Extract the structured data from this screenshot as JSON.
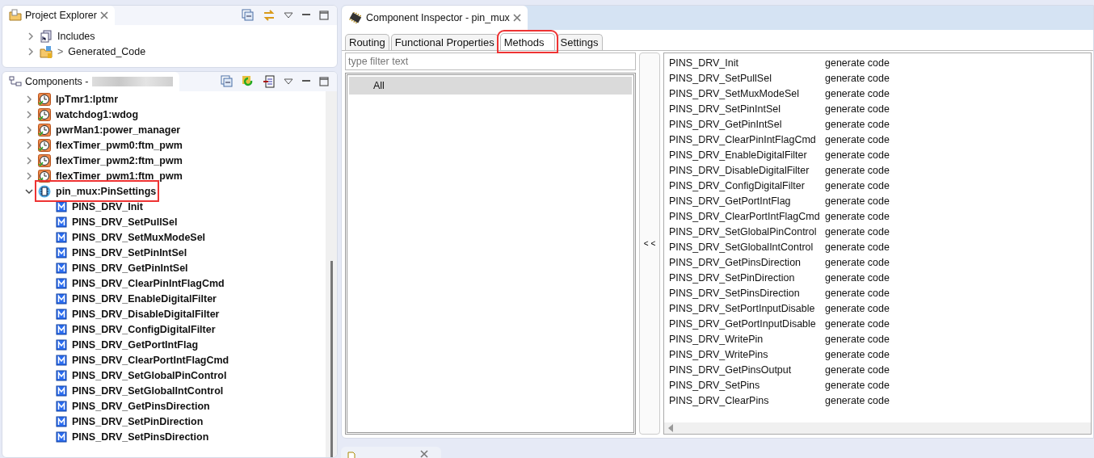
{
  "project_explorer": {
    "title": "Project Explorer",
    "items": [
      {
        "label": "Includes",
        "expanded": false
      },
      {
        "label": "Generated_Code",
        "expanded": false,
        "prefix": ">"
      }
    ]
  },
  "components": {
    "title": "Components -",
    "items": [
      {
        "label": "lpTmr1:lptmr",
        "expanded": false,
        "highlighted": false
      },
      {
        "label": "watchdog1:wdog",
        "expanded": false,
        "highlighted": false
      },
      {
        "label": "pwrMan1:power_manager",
        "expanded": false,
        "highlighted": false
      },
      {
        "label": "flexTimer_pwm0:ftm_pwm",
        "expanded": false,
        "highlighted": false
      },
      {
        "label": "flexTimer_pwm2:ftm_pwm",
        "expanded": false,
        "highlighted": false
      },
      {
        "label": "flexTimer_pwm1:ftm_pwm",
        "expanded": false,
        "highlighted": false
      },
      {
        "label": "pin_mux:PinSettings",
        "expanded": true,
        "highlighted": true,
        "children": [
          {
            "label": "PINS_DRV_Init"
          },
          {
            "label": "PINS_DRV_SetPullSel"
          },
          {
            "label": "PINS_DRV_SetMuxModeSel"
          },
          {
            "label": "PINS_DRV_SetPinIntSel"
          },
          {
            "label": "PINS_DRV_GetPinIntSel"
          },
          {
            "label": "PINS_DRV_ClearPinIntFlagCmd"
          },
          {
            "label": "PINS_DRV_EnableDigitalFilter"
          },
          {
            "label": "PINS_DRV_DisableDigitalFilter"
          },
          {
            "label": "PINS_DRV_ConfigDigitalFilter"
          },
          {
            "label": "PINS_DRV_GetPortIntFlag"
          },
          {
            "label": "PINS_DRV_ClearPortIntFlagCmd"
          },
          {
            "label": "PINS_DRV_SetGlobalPinControl"
          },
          {
            "label": "PINS_DRV_SetGlobalIntControl"
          },
          {
            "label": "PINS_DRV_GetPinsDirection"
          },
          {
            "label": "PINS_DRV_SetPinDirection"
          },
          {
            "label": "PINS_DRV_SetPinsDirection"
          }
        ]
      }
    ]
  },
  "inspector": {
    "title": "Component Inspector - pin_mux",
    "tabs": [
      {
        "label": "Routing",
        "selected": false,
        "highlighted": false
      },
      {
        "label": "Functional Properties",
        "selected": false,
        "highlighted": false
      },
      {
        "label": "Methods",
        "selected": true,
        "highlighted": true
      },
      {
        "label": "Settings",
        "selected": false,
        "highlighted": false
      }
    ],
    "filter": {
      "placeholder": "type filter text"
    },
    "groups": [
      {
        "label": "All",
        "selected": true
      }
    ],
    "move_button": "< <",
    "methods": [
      {
        "name": "PINS_DRV_Init",
        "action": "generate code"
      },
      {
        "name": "PINS_DRV_SetPullSel",
        "action": "generate code"
      },
      {
        "name": "PINS_DRV_SetMuxModeSel",
        "action": "generate code"
      },
      {
        "name": "PINS_DRV_SetPinIntSel",
        "action": "generate code"
      },
      {
        "name": "PINS_DRV_GetPinIntSel",
        "action": "generate code"
      },
      {
        "name": "PINS_DRV_ClearPinIntFlagCmd",
        "action": "generate code"
      },
      {
        "name": "PINS_DRV_EnableDigitalFilter",
        "action": "generate code"
      },
      {
        "name": "PINS_DRV_DisableDigitalFilter",
        "action": "generate code"
      },
      {
        "name": "PINS_DRV_ConfigDigitalFilter",
        "action": "generate code"
      },
      {
        "name": "PINS_DRV_GetPortIntFlag",
        "action": "generate code"
      },
      {
        "name": "PINS_DRV_ClearPortIntFlagCmd",
        "action": "generate code"
      },
      {
        "name": "PINS_DRV_SetGlobalPinControl",
        "action": "generate code"
      },
      {
        "name": "PINS_DRV_SetGlobalIntControl",
        "action": "generate code"
      },
      {
        "name": "PINS_DRV_GetPinsDirection",
        "action": "generate code"
      },
      {
        "name": "PINS_DRV_SetPinDirection",
        "action": "generate code"
      },
      {
        "name": "PINS_DRV_SetPinsDirection",
        "action": "generate code"
      },
      {
        "name": "PINS_DRV_SetPortInputDisable",
        "action": "generate code"
      },
      {
        "name": "PINS_DRV_GetPortInputDisable",
        "action": "generate code"
      },
      {
        "name": "PINS_DRV_WritePin",
        "action": "generate code"
      },
      {
        "name": "PINS_DRV_WritePins",
        "action": "generate code"
      },
      {
        "name": "PINS_DRV_GetPinsOutput",
        "action": "generate code"
      },
      {
        "name": "PINS_DRV_SetPins",
        "action": "generate code"
      },
      {
        "name": "PINS_DRV_ClearPins",
        "action": "generate code"
      }
    ]
  }
}
